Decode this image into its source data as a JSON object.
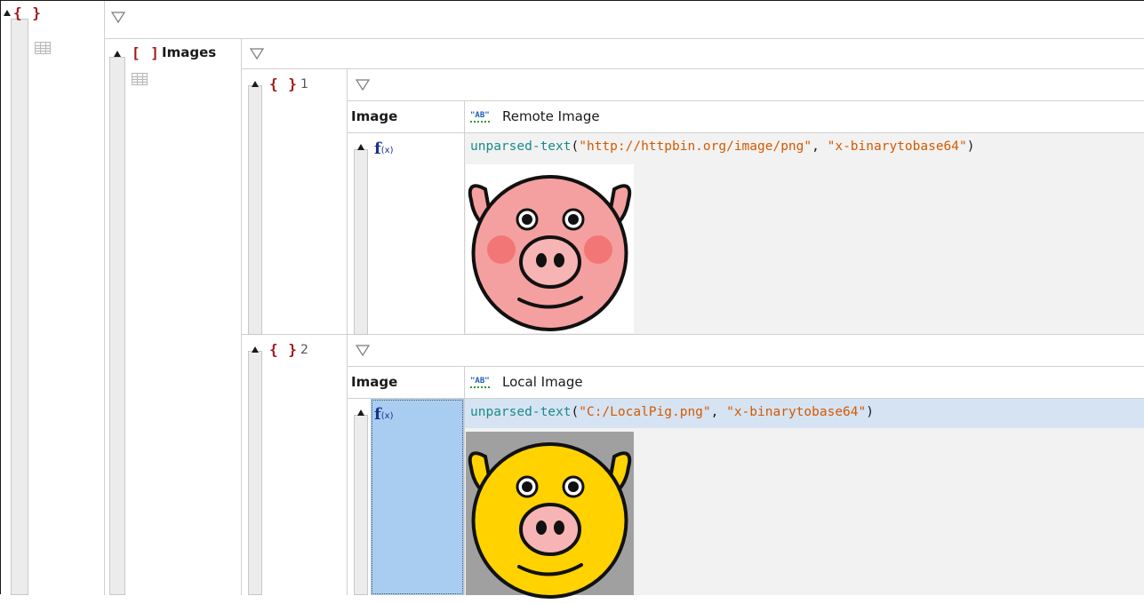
{
  "root": {
    "brace": "{ }"
  },
  "images_array": {
    "brace": "[ ]",
    "label": "Images"
  },
  "items": [
    {
      "brace": "{ }",
      "index": "1",
      "key": "Image",
      "value_type_icon": "\"AB\"",
      "value": "Remote Image",
      "formula_icon": "f(x)",
      "formula": {
        "fn": "unparsed-text",
        "open": "(",
        "arg1": "\"http://httpbin.org/image/png\"",
        "sep": ", ",
        "arg2": "\"x-binarytobase64\"",
        "close": ")"
      },
      "image": {
        "description_icon": "pig-face-pink",
        "face_color": "#f4a0a0",
        "ear_color": "#f4a0a0",
        "cheek_color": "#f26b6b",
        "bg": "#ffffff"
      }
    },
    {
      "brace": "{ }",
      "index": "2",
      "key": "Image",
      "value_type_icon": "\"AB\"",
      "value": "Local Image",
      "formula_icon": "f(x)",
      "formula": {
        "fn": "unparsed-text",
        "open": "(",
        "arg1": "\"C:/LocalPig.png\"",
        "sep": ", ",
        "arg2": "\"x-binarytobase64\"",
        "close": ")"
      },
      "image": {
        "description_icon": "pig-face-yellow",
        "face_color": "#ffd200",
        "ear_color": "#ffd200",
        "bg": "#a0a0a0"
      }
    }
  ],
  "colors": {
    "brace": "#a01818",
    "function": "#1a8a8a",
    "string": "#d35a00",
    "selection": "#d6e3f2",
    "fx_selected": "#a9cdf1"
  }
}
